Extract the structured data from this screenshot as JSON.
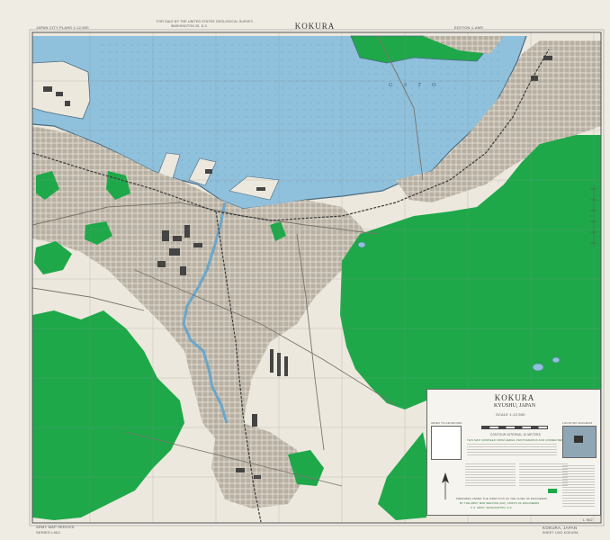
{
  "sheet": {
    "title_top": "KOKURA",
    "series_label": "JAPAN CITY PLANS 1:12,500",
    "header_note_1": "FOR SALE BY THE UNITED STATES GEOLOGICAL SURVEY",
    "header_note_2": "WASHINGTON 25, D.C.",
    "edition_top_right": "EDITION 1-AMS",
    "bottom_left_1": "ARMY MAP SERVICE",
    "bottom_left_2": "SERIES L902",
    "bottom_right_1": "KOKURA, JAPAN",
    "bottom_right_2": "SHEET L902-KOKURA",
    "sheet_number": "L 902"
  },
  "map_labels": {
    "sea_name": "G   S   T   O"
  },
  "legend": {
    "title": "KOKURA",
    "subtitle": "KYUSHU, JAPAN",
    "scale_label": "SCALE 1:12,500",
    "contour_note": "CONTOUR INTERVAL 10 METERS",
    "compiled_note": "THIS MAP COMPILED FROM AERIAL PHOTOGRAPHS AND CORRECTED BY PUBLISHED MAPS",
    "index_label": "INDEX TO ADJOINING",
    "location_label": "LOCATION DIAGRAM",
    "agency_note_1": "PREPARED UNDER THE DIRECTION OF THE CHIEF OF ENGINEERS",
    "agency_note_2": "BY THE ARMY MAP SERVICE (AM), CORPS OF ENGINEERS",
    "agency_note_3": "U.S. ARMY, WASHINGTON, D.C."
  },
  "colors": {
    "water": "#8fc0dc",
    "vegetation": "#1fa84a",
    "urban": "#b5ada0",
    "land": "#ece8dd",
    "frame": "#6a6a6a"
  }
}
